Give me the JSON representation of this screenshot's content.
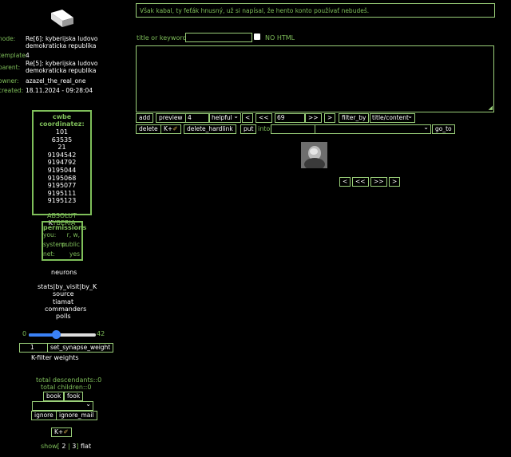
{
  "top_message": "Však kabal, ty feťák hnusný, už si napísal, že hento konto používať nebudeš.",
  "meta": {
    "node_label": "node:",
    "node_value": "Re[6]: kyberijska ludovo demokraticka republika",
    "template_label": "template:",
    "template_value": "4",
    "parent_label": "parent:",
    "parent_value": "Re[5]: kyberijska ludovo demokraticka republika",
    "owner_label": "owner:",
    "owner_value": "azazel_the_real_one",
    "created_label": "created:",
    "created_value": "18.11.2024 - 09:28:04"
  },
  "coords": {
    "title": "cwbe coordinatez:",
    "values": [
      "101",
      "63535",
      "21",
      "9194542",
      "9194792",
      "9195044",
      "9195068",
      "9195077",
      "9195111",
      "9195123"
    ],
    "absolut": "ABSOLUT",
    "kyberia_k": "K",
    "kyberia_rest": "YBERIA"
  },
  "permissions": {
    "title": "permissions",
    "rows": [
      {
        "label": "you:",
        "value": "r, w,"
      },
      {
        "label": "system:",
        "value": "public"
      },
      {
        "label": "net:",
        "value": "yes"
      }
    ]
  },
  "nav": {
    "neurons": "neurons",
    "stats": "stats",
    "by_visit": "by_visit",
    "by_k": "by_K",
    "source": "source",
    "tiamat": "tiamat",
    "commanders": "commanders",
    "polls": "polls"
  },
  "slider": {
    "min_label": "0",
    "max_label": "42",
    "value": 17,
    "max": 42
  },
  "synapse": {
    "value": "1",
    "button": "set_synapse_weight"
  },
  "kfilter": "K-filter weights",
  "descendants": "total descendants::0",
  "children": "total children::0",
  "book_btn": "book",
  "fook_btn": "fook",
  "ignore_btn": "ignore",
  "ignore_mail_btn": "ignore_mail",
  "kplus_btn": "K+",
  "show": {
    "prefix": "show[",
    "opt2": "2",
    "sep": "|",
    "opt3": "3",
    "suffix": "]",
    "flat": "flat"
  },
  "form": {
    "title_label": "title or keywords::",
    "nohtml_label": "NO HTML"
  },
  "toolbar": {
    "add": "add",
    "preview": "preview",
    "count": "4",
    "helpful": "helpful",
    "prev": "<",
    "prev2": "<<",
    "page": "69",
    "next2": ">>",
    "next": ">",
    "filter_by": "filter_by",
    "title_content": "title/content",
    "delete": "delete",
    "kplus": "K+",
    "delete_hardlink": "delete_hardlink",
    "put": "put",
    "into": "into",
    "go_to": "go_to"
  },
  "pager": {
    "prev": "<",
    "prev2": "<<",
    "next2": ">>",
    "next": ">"
  },
  "colors": {
    "accent": "#7fbf5a",
    "border": "#9bd07a",
    "bg": "#000000"
  }
}
